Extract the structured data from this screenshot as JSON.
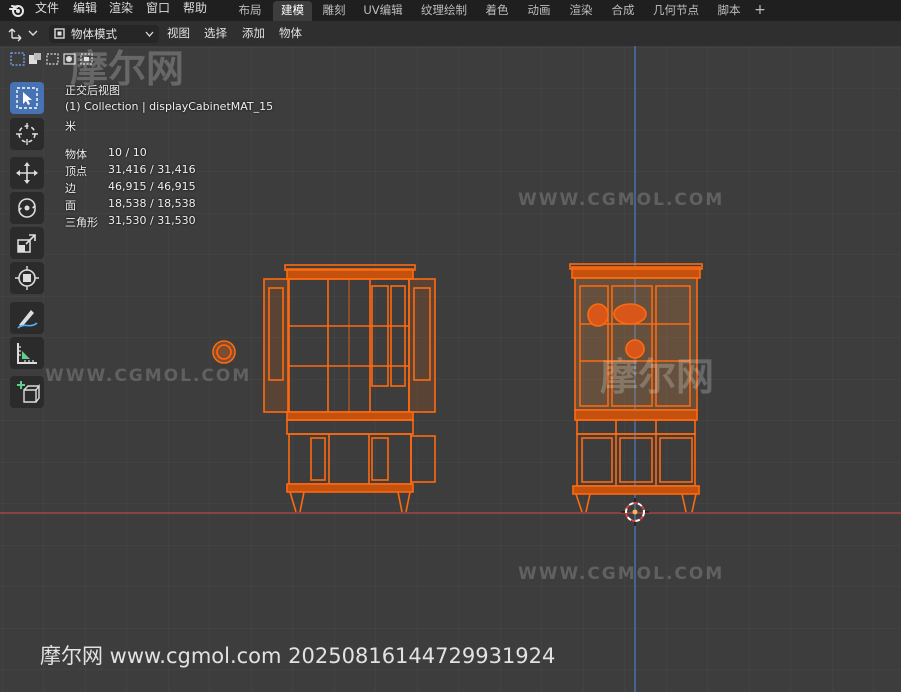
{
  "topbar": {
    "menus": [
      "文件",
      "编辑",
      "渲染",
      "窗口",
      "帮助"
    ],
    "workspace_tabs": [
      "布局",
      "建模",
      "雕刻",
      "UV编辑",
      "纹理绘制",
      "着色",
      "动画",
      "渲染",
      "合成",
      "几何节点",
      "脚本"
    ],
    "active_tab": "建模",
    "add_tab": "+"
  },
  "header": {
    "mode": "物体模式",
    "menus": [
      "视图",
      "选择",
      "添加",
      "物体"
    ]
  },
  "overlay": {
    "view_name": "正交后视图",
    "collection": "(1) Collection | displayCabinetMAT_15",
    "unit": "米",
    "stats": [
      {
        "label": "物体",
        "value": "10 / 10"
      },
      {
        "label": "顶点",
        "value": "31,416 / 31,416"
      },
      {
        "label": "边",
        "value": "46,915 / 46,915"
      },
      {
        "label": "面",
        "value": "18,538 / 18,538"
      },
      {
        "label": "三角形",
        "value": "31,530 / 31,530"
      }
    ]
  },
  "tools": [
    "select-box-icon",
    "cursor-icon",
    "move-icon",
    "rotate-icon",
    "scale-icon",
    "transform-icon",
    "annotate-icon",
    "measure-icon",
    "add-cube-icon"
  ],
  "colors": {
    "accent": "#4772b3",
    "selection": "#ff7a1a",
    "x_axis": "#d94a4a",
    "z_axis": "#4a78c8"
  },
  "watermarks": {
    "site": "WWW.CGMOL.COM",
    "brand": "摩尔网",
    "footer": "摩尔网 www.cgmol.com 20250816144729931924"
  }
}
